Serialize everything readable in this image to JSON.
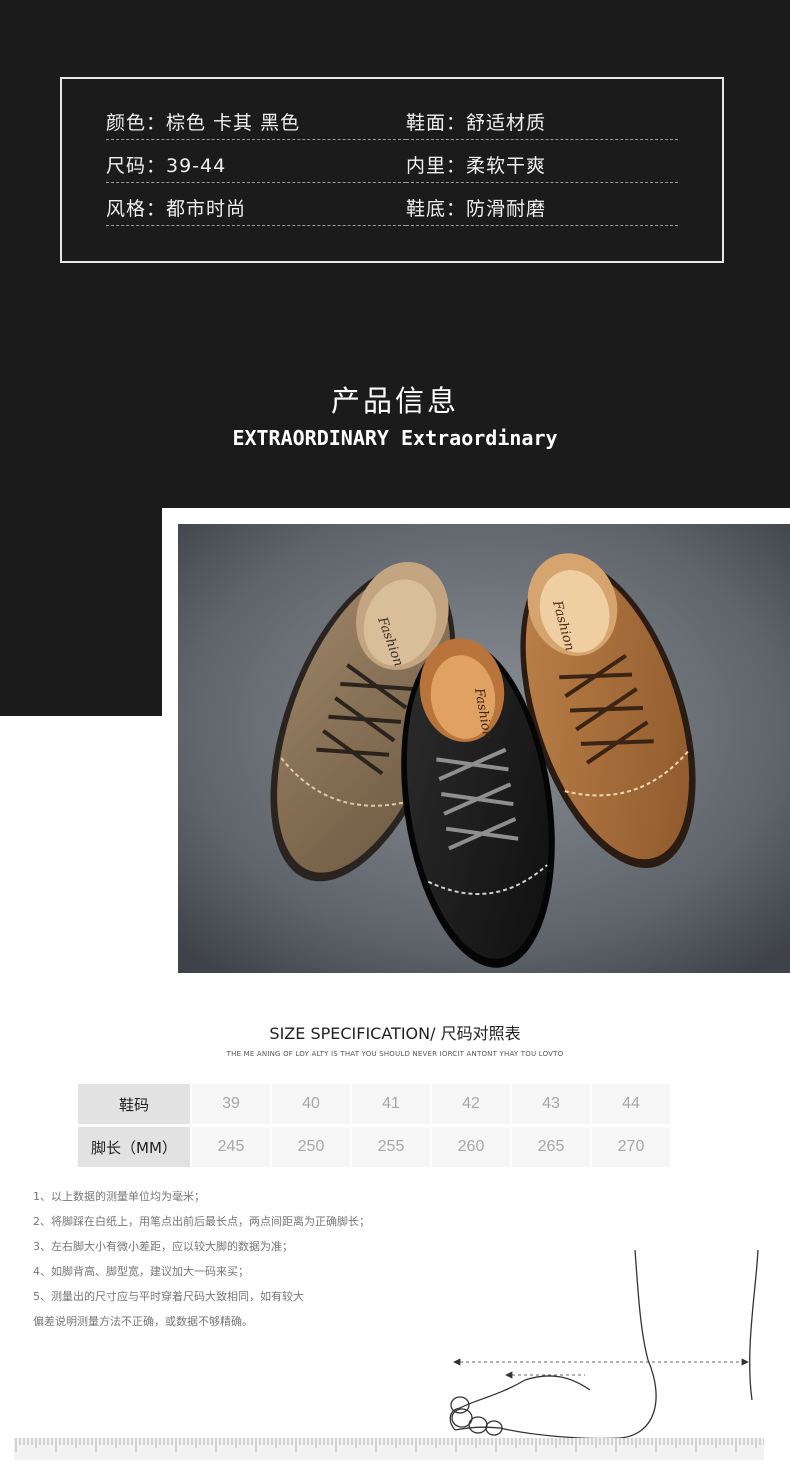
{
  "info": {
    "rows": [
      {
        "left": "颜色：棕色  卡其  黑色",
        "right": "鞋面：舒适材质"
      },
      {
        "left": "尺码：39-44",
        "right": "内里：柔软干爽"
      },
      {
        "left": "风格：都市时尚",
        "right": "鞋底：防滑耐磨"
      }
    ]
  },
  "section": {
    "title_cn": "产品信息",
    "title_en": "EXTRAORDINARY  Extraordinary"
  },
  "photo": {
    "brand_text": "Fashion"
  },
  "size_spec": {
    "title": "SIZE SPECIFICATION/ 尺码对照表",
    "subtitle": "THE ME ANING OF LOY ALTY IS THAT YOU SHOULD NEVER IORCIT ANTONT YHAY TOU LOVTO",
    "row1_header": "鞋码",
    "row2_header": "脚长（MM）",
    "sizes": [
      "39",
      "40",
      "41",
      "42",
      "43",
      "44"
    ],
    "lengths": [
      "245",
      "250",
      "255",
      "260",
      "265",
      "270"
    ]
  },
  "notes": [
    "1、以上数据的测量单位均为毫米；",
    "2、将脚踩在白纸上，用笔点出前后最长点，两点间距离为正确脚长；",
    "3、左右脚大小有微小差距，应以较大脚的数据为准；",
    "4、如脚背高、脚型宽，建议加大一码来买；",
    "5、测量出的尺寸应与平时穿着尺码大致相同，如有较大",
    "    偏差说明测量方法不正确，或数据不够精确。"
  ],
  "colors": {
    "dark_bg": "#1b1b1b",
    "leather_khaki": "#8a7358",
    "leather_brown": "#a46a38",
    "leather_black": "#1a1a1a"
  }
}
